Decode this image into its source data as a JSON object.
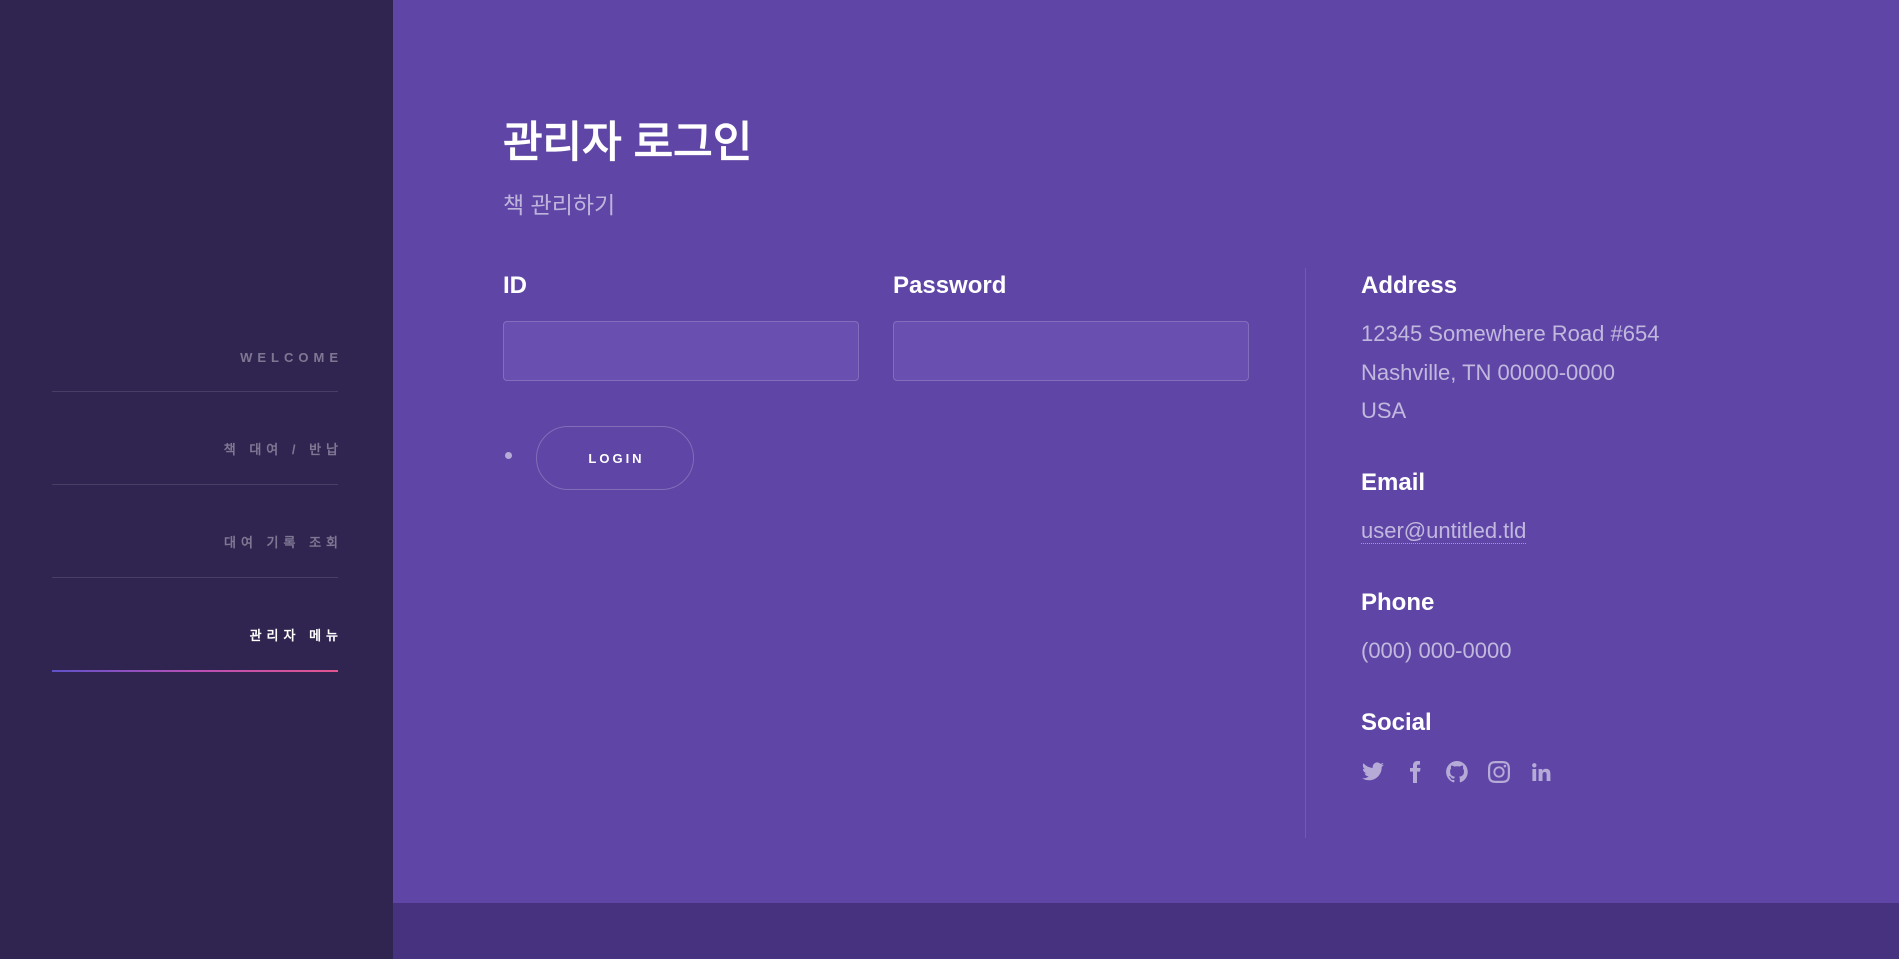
{
  "sidebar": {
    "items": [
      {
        "label": "WELCOME",
        "active": false
      },
      {
        "label": "책 대여 / 반납",
        "active": false
      },
      {
        "label": "대여 기록 조회",
        "active": false
      },
      {
        "label": "관리자 메뉴",
        "active": true
      }
    ]
  },
  "main": {
    "title": "관리자 로그인",
    "subtitle": "책 관리하기"
  },
  "form": {
    "id_label": "ID",
    "id_value": "",
    "password_label": "Password",
    "password_value": "",
    "login_label": "LOGIN"
  },
  "contact": {
    "address_heading": "Address",
    "address_lines": [
      "12345 Somewhere Road #654",
      "Nashville, TN 00000-0000",
      "USA"
    ],
    "email_heading": "Email",
    "email": "user@untitled.tld",
    "phone_heading": "Phone",
    "phone": "(000) 000-0000",
    "social_heading": "Social",
    "social_icons": [
      "twitter-icon",
      "facebook-icon",
      "github-icon",
      "instagram-icon",
      "linkedin-icon"
    ]
  },
  "colors": {
    "sidebar_bg": "#302450",
    "main_bg": "#5e45a6",
    "footer_band": "#47327f",
    "active_underline_start": "#5e52c9",
    "active_underline_end": "#e2558f"
  }
}
